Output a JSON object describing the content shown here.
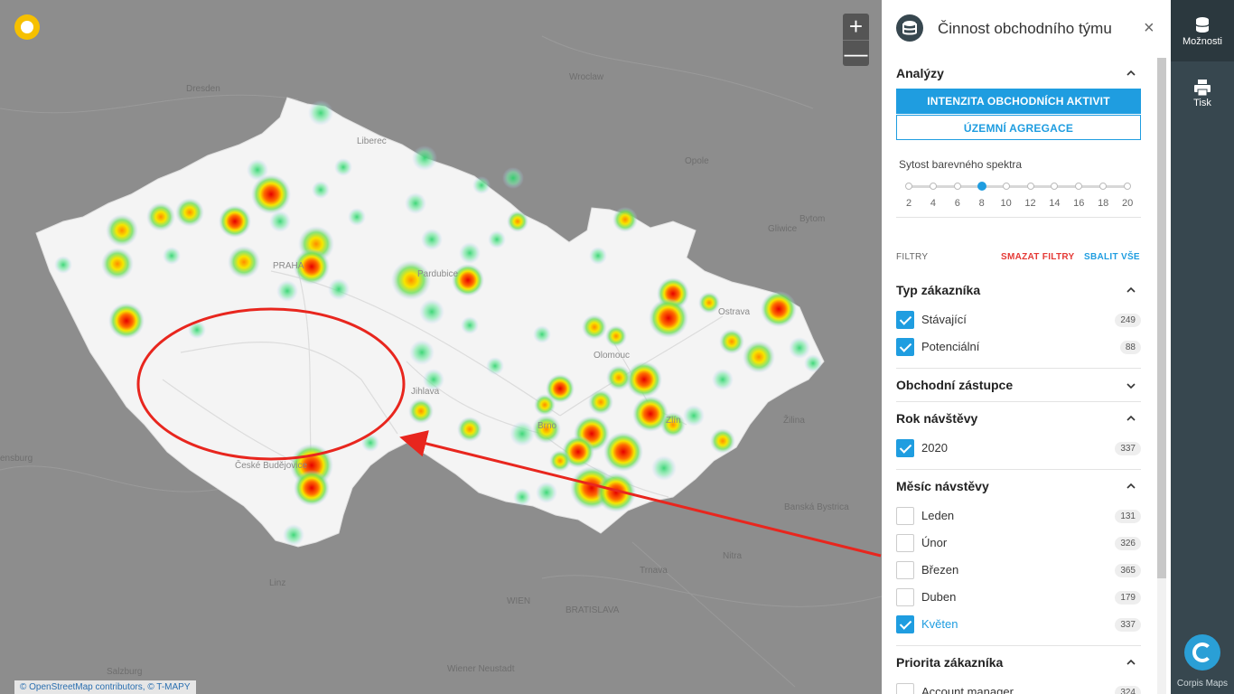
{
  "map": {
    "attribution": "© OpenStreetMap contributors, © T-MAPY",
    "zoom_in": "+",
    "zoom_out": "—",
    "cities": [
      {
        "name": "Dresden",
        "cls": ""
      },
      {
        "name": "Liberec",
        "cls": "in"
      },
      {
        "name": "Wroclaw",
        "cls": ""
      },
      {
        "name": "Opole",
        "cls": ""
      },
      {
        "name": "Bytom",
        "cls": ""
      },
      {
        "name": "Gliwice",
        "cls": ""
      },
      {
        "name": "PRAHA",
        "cls": "in"
      },
      {
        "name": "Pardubice",
        "cls": "in"
      },
      {
        "name": "Ostrava",
        "cls": "in"
      },
      {
        "name": "Olomouc",
        "cls": "in"
      },
      {
        "name": "Jihlava",
        "cls": "in"
      },
      {
        "name": "Brno",
        "cls": "in"
      },
      {
        "name": "Zlín",
        "cls": "in"
      },
      {
        "name": "Žilina",
        "cls": ""
      },
      {
        "name": "České Budějovice",
        "cls": "in"
      },
      {
        "name": "Banská Bystrica",
        "cls": ""
      },
      {
        "name": "Trnava",
        "cls": ""
      },
      {
        "name": "Linz",
        "cls": ""
      },
      {
        "name": "WIEN",
        "cls": ""
      },
      {
        "name": "BRATISLAVA",
        "cls": ""
      },
      {
        "name": "Wiener Neustadt",
        "cls": ""
      },
      {
        "name": "Salzburg",
        "cls": ""
      },
      {
        "name": "Nitra",
        "cls": ""
      },
      {
        "name": "ensburg",
        "cls": ""
      }
    ]
  },
  "panel": {
    "title": "Činnost obchodního týmu",
    "close": "×",
    "analyzy": {
      "title": "Analýzy",
      "btn_primary": "INTENZITA OBCHODNÍCH AKTIVIT",
      "btn_secondary": "ÚZEMNÍ AGREGACE",
      "spectrum_label": "Sytost barevného spektra",
      "ticks": [
        "2",
        "4",
        "6",
        "8",
        "10",
        "12",
        "14",
        "16",
        "18",
        "20"
      ],
      "selected": 8
    },
    "filters": {
      "label": "FILTRY",
      "clear": "SMAZAT FILTRY",
      "collapse": "SBALIT VŠE",
      "clear_color": "#e53935",
      "collapse_color": "#1f9de0"
    },
    "typ": {
      "title": "Typ zákazníka",
      "items": [
        {
          "label": "Stávající",
          "count": "249",
          "checked": true
        },
        {
          "label": "Potenciální",
          "count": "88",
          "checked": true
        }
      ]
    },
    "zastupce": {
      "title": "Obchodní zástupce"
    },
    "rok": {
      "title": "Rok návštěvy",
      "items": [
        {
          "label": "2020",
          "count": "337",
          "checked": true
        }
      ]
    },
    "mesic": {
      "title": "Měsíc návstěvy",
      "items": [
        {
          "label": "Leden",
          "count": "131",
          "checked": false
        },
        {
          "label": "Únor",
          "count": "326",
          "checked": false
        },
        {
          "label": "Březen",
          "count": "365",
          "checked": false
        },
        {
          "label": "Duben",
          "count": "179",
          "checked": false
        },
        {
          "label": "Květen",
          "count": "337",
          "checked": true
        }
      ]
    },
    "priorita": {
      "title": "Priorita zákazníka",
      "items": [
        {
          "label": "Account manager",
          "count": "324",
          "checked": false
        }
      ]
    }
  },
  "rail": {
    "options": "Možnosti",
    "print": "Tisk",
    "brand": "Corpis Maps"
  },
  "colors": {
    "accent": "#1f9de0",
    "rail": "#37474f",
    "annotation": "#e8261e"
  }
}
